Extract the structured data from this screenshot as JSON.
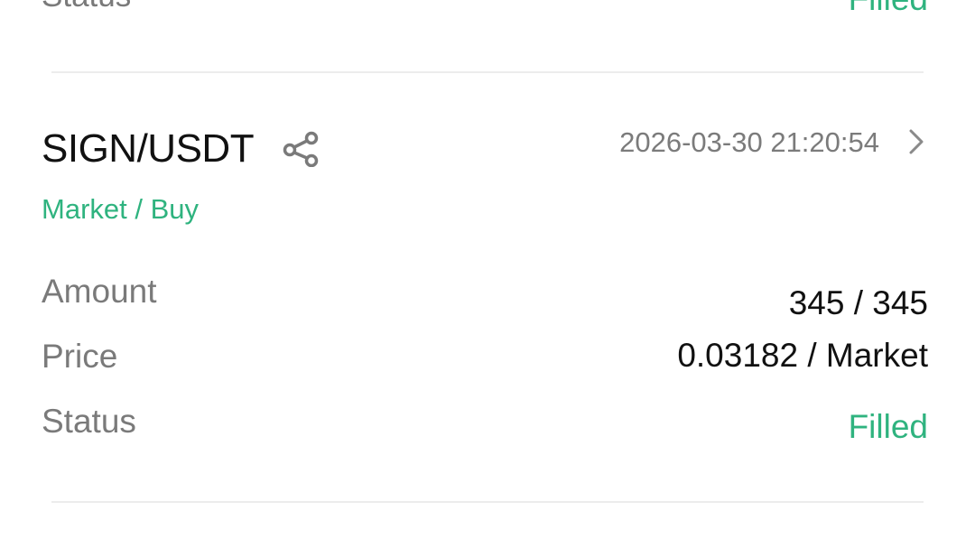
{
  "previous_order": {
    "status_label": "Status",
    "status_value": "Filled"
  },
  "order": {
    "pair": "SIGN/USDT",
    "share_icon": "share-icon",
    "datetime": "2026-03-30 21:20:54",
    "chevron_icon": "chevron-right-icon",
    "order_type": "Market / Buy",
    "amount_label": "Amount",
    "amount_value": "345 / 345",
    "price_label": "Price",
    "price_value": "0.03182 / Market",
    "status_label": "Status",
    "status_value": "Filled"
  },
  "colors": {
    "accent_green": "#2fb37f",
    "label_gray": "#7a7a7a",
    "text_dark": "#111111",
    "divider": "#ececec"
  }
}
